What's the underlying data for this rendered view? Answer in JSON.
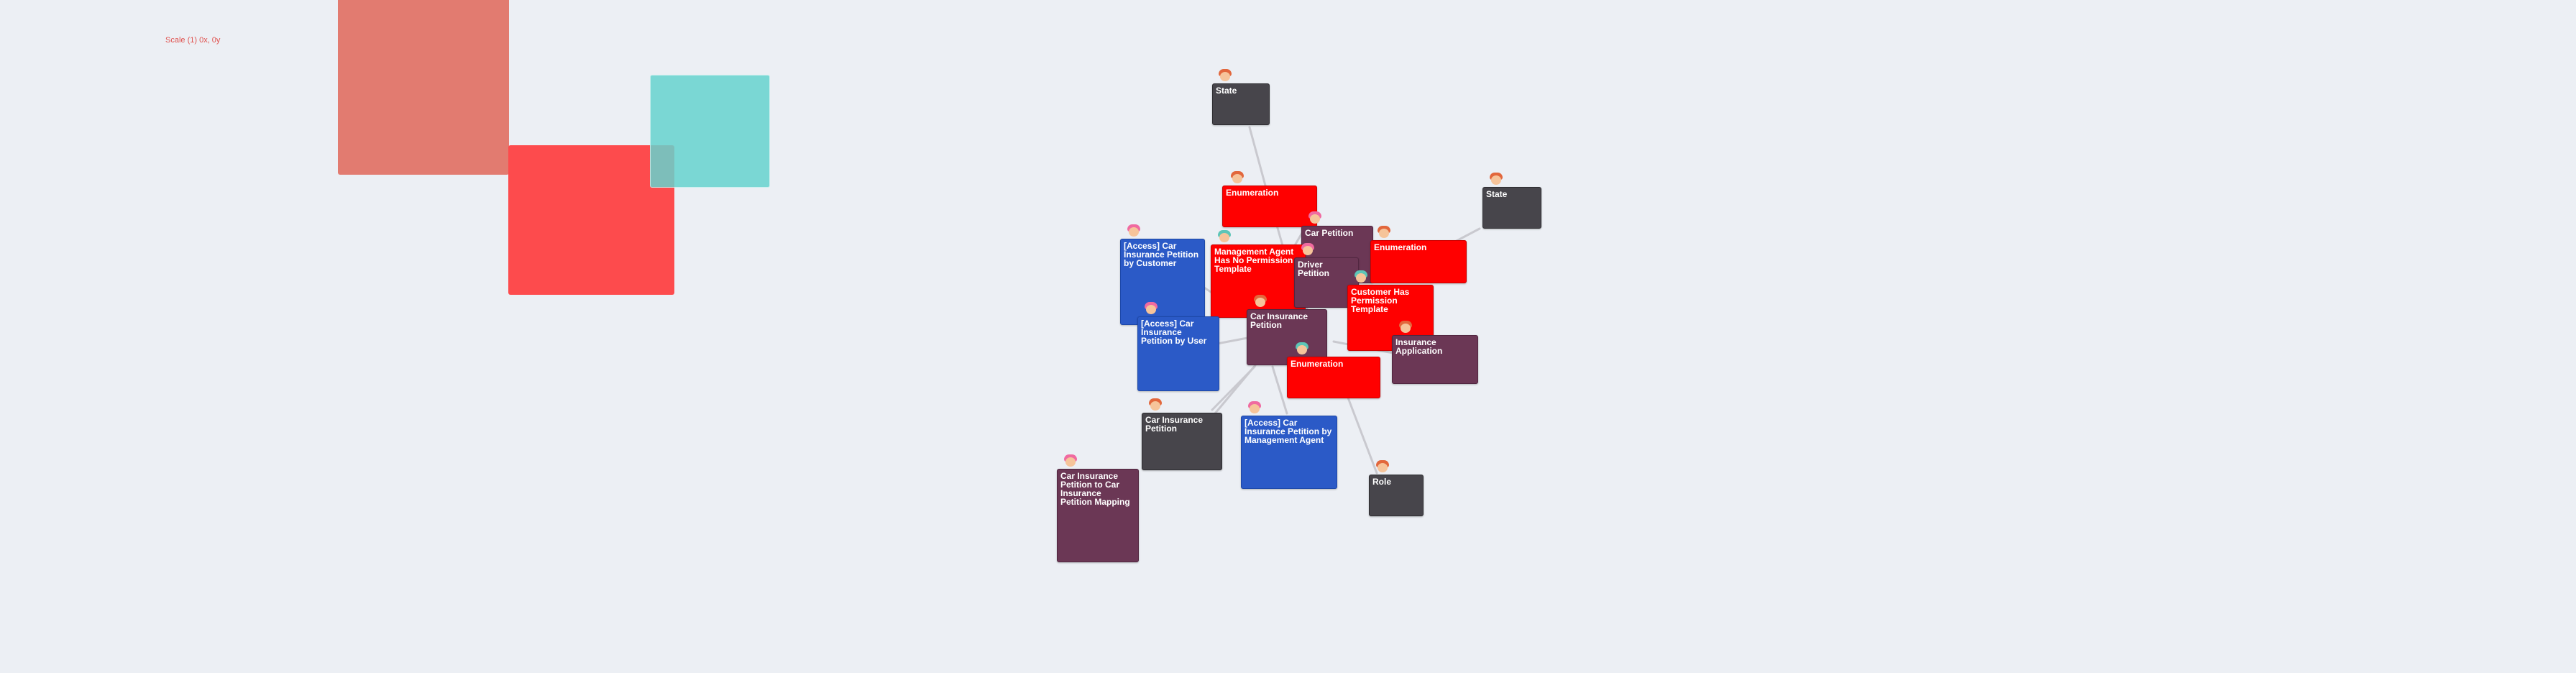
{
  "scale_label": "Scale (1) 0x, 0y",
  "colors": {
    "background": "#eceff4",
    "state": "#47454b",
    "enumeration": "#ff0000",
    "access": "#2b5ac7",
    "entity": "#6b3755",
    "edge": "#c9c9cf"
  },
  "nodes": [
    {
      "id": "n-state-top",
      "label": "State",
      "kind": "state",
      "avatar": "orange"
    },
    {
      "id": "n-enum-1",
      "label": "Enumeration",
      "kind": "enum",
      "avatar": "orange"
    },
    {
      "id": "n-state-right",
      "label": "State",
      "kind": "state",
      "avatar": "orange"
    },
    {
      "id": "n-car-petition",
      "label": "Car Petition",
      "kind": "entity",
      "avatar": "pink"
    },
    {
      "id": "n-enum-2",
      "label": "Enumeration",
      "kind": "enum",
      "avatar": "orange"
    },
    {
      "id": "n-access-customer",
      "label": "[Access] Car Insurance Petition by Customer",
      "kind": "access",
      "avatar": "pink"
    },
    {
      "id": "n-mgmt-template",
      "label": "Management Agent Has No Permission Template",
      "kind": "enum",
      "avatar": "teal"
    },
    {
      "id": "n-driver-petition",
      "label": "Driver Petition",
      "kind": "entity",
      "avatar": "pink"
    },
    {
      "id": "n-customer-template",
      "label": "Customer Has Permission Template",
      "kind": "enum",
      "avatar": "teal"
    },
    {
      "id": "n-car-ins-petition",
      "label": "Car Insurance Petition",
      "kind": "entity",
      "avatar": "orange"
    },
    {
      "id": "n-access-user",
      "label": "[Access] Car Insurance Petition by User",
      "kind": "access",
      "avatar": "pink"
    },
    {
      "id": "n-ins-application",
      "label": "Insurance Application",
      "kind": "entity",
      "avatar": "orange"
    },
    {
      "id": "n-enum-3",
      "label": "Enumeration",
      "kind": "enum",
      "avatar": "teal"
    },
    {
      "id": "n-car-ins-petition-2",
      "label": "Car Insurance Petition",
      "kind": "state",
      "avatar": "orange"
    },
    {
      "id": "n-access-mgmt",
      "label": "[Access] Car Insurance Petition by Management Agent",
      "kind": "access",
      "avatar": "pink"
    },
    {
      "id": "n-mapping",
      "label": "Car Insurance Petition to Car Insurance Petition Mapping",
      "kind": "entity",
      "avatar": "pink"
    },
    {
      "id": "n-role",
      "label": "Role",
      "kind": "state",
      "avatar": "orange"
    }
  ]
}
